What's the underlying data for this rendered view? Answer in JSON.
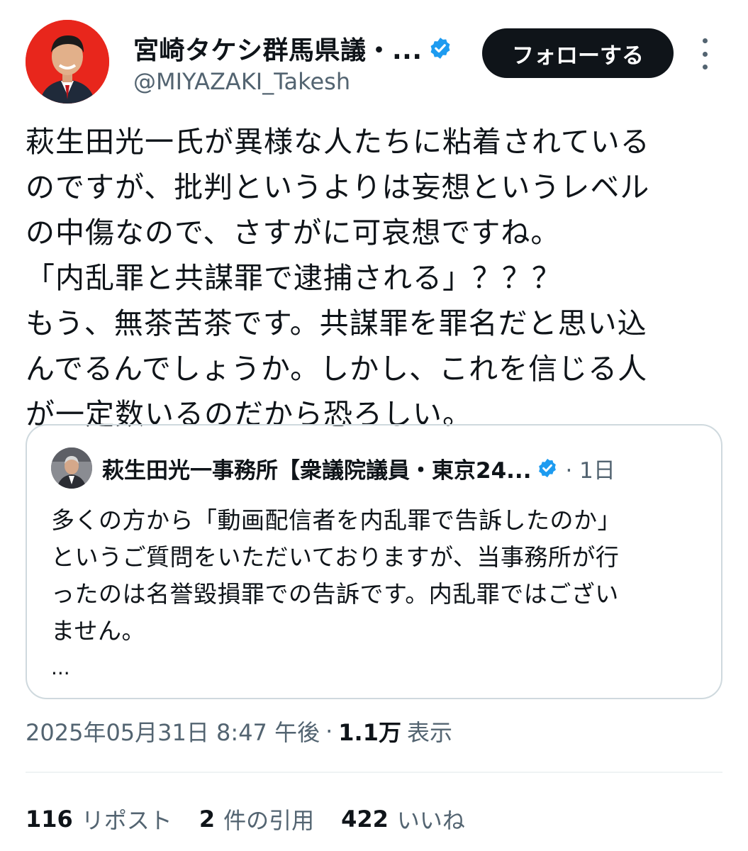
{
  "author": {
    "display_name": "宮崎タケシ群馬県議・...",
    "handle": "@MIYAZAKI_Takesh",
    "verified": true,
    "avatar_bg": "#e8261c",
    "follow_label": "フォローする"
  },
  "tweet": {
    "lines": [
      "萩生田光一氏が異様な人たちに粘着されている",
      "のですが、批判というよりは妄想というレベル",
      "の中傷なので、さすがに可哀想ですね。",
      "「内乱罪と共謀罪で逮捕される」？？？",
      "もう、無茶苦茶です。共謀罪を罪名だと思い込",
      "んでるんでしょうか。しかし、これを信じる人",
      "が一定数いるのだから恐ろしい。"
    ]
  },
  "quote": {
    "author_name": "萩生田光一事務所【衆議院議員・東京24...",
    "verified": true,
    "time": "· 1日",
    "lines": [
      "多くの方から「動画配信者を内乱罪で告訴したのか」",
      "というご質問をいただいておりますが、当事務所が行",
      "ったのは名誉毀損罪での告訴です。内乱罪ではござい",
      "ません。"
    ],
    "ellipsis": "..."
  },
  "meta": {
    "timestamp": "2025年05月31日 8:47 午後",
    "separator": "·",
    "views": "1.1万",
    "views_label": "表示"
  },
  "stats": {
    "reposts": {
      "count": "116",
      "label": "リポスト"
    },
    "quotes": {
      "count": "2",
      "label": "件の引用"
    },
    "likes": {
      "count": "422",
      "label": "いいね"
    }
  },
  "colors": {
    "text_primary": "#0f1419",
    "text_secondary": "#536471",
    "verified_blue": "#1d9bf0",
    "border": "#cfd9de"
  },
  "icons": [
    "verified-badge-icon",
    "more-options-icon"
  ]
}
